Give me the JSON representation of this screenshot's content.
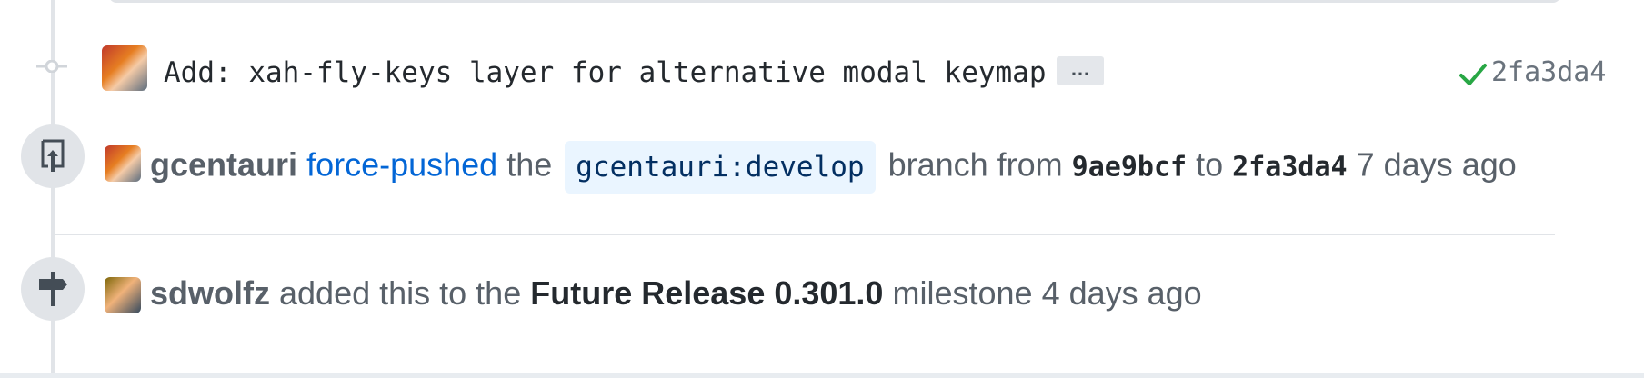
{
  "commit": {
    "message": "Add: xah-fly-keys layer for alternative modal keymap",
    "ellipsis": "…",
    "sha": "2fa3da4",
    "status": "success"
  },
  "force_push": {
    "actor": "gcentauri",
    "action": "force-pushed",
    "the": "the",
    "branch_ref": "gcentauri:develop",
    "branch_from": "branch from",
    "from_sha": "9ae9bcf",
    "to": "to",
    "to_sha": "2fa3da4",
    "time": "7 days ago"
  },
  "milestone_event": {
    "actor": "sdwolfz",
    "action": "added this to the",
    "milestone": "Future Release 0.301.0",
    "suffix": "milestone",
    "time": "4 days ago"
  },
  "colors": {
    "link": "#0366d6",
    "success": "#28a745",
    "branch_bg": "#eaf5ff",
    "badge_bg": "#e1e4e8"
  },
  "icons": {
    "commit": "git-commit-icon",
    "force_push": "repo-push-icon",
    "milestone": "milestone-icon",
    "check": "check-icon"
  }
}
